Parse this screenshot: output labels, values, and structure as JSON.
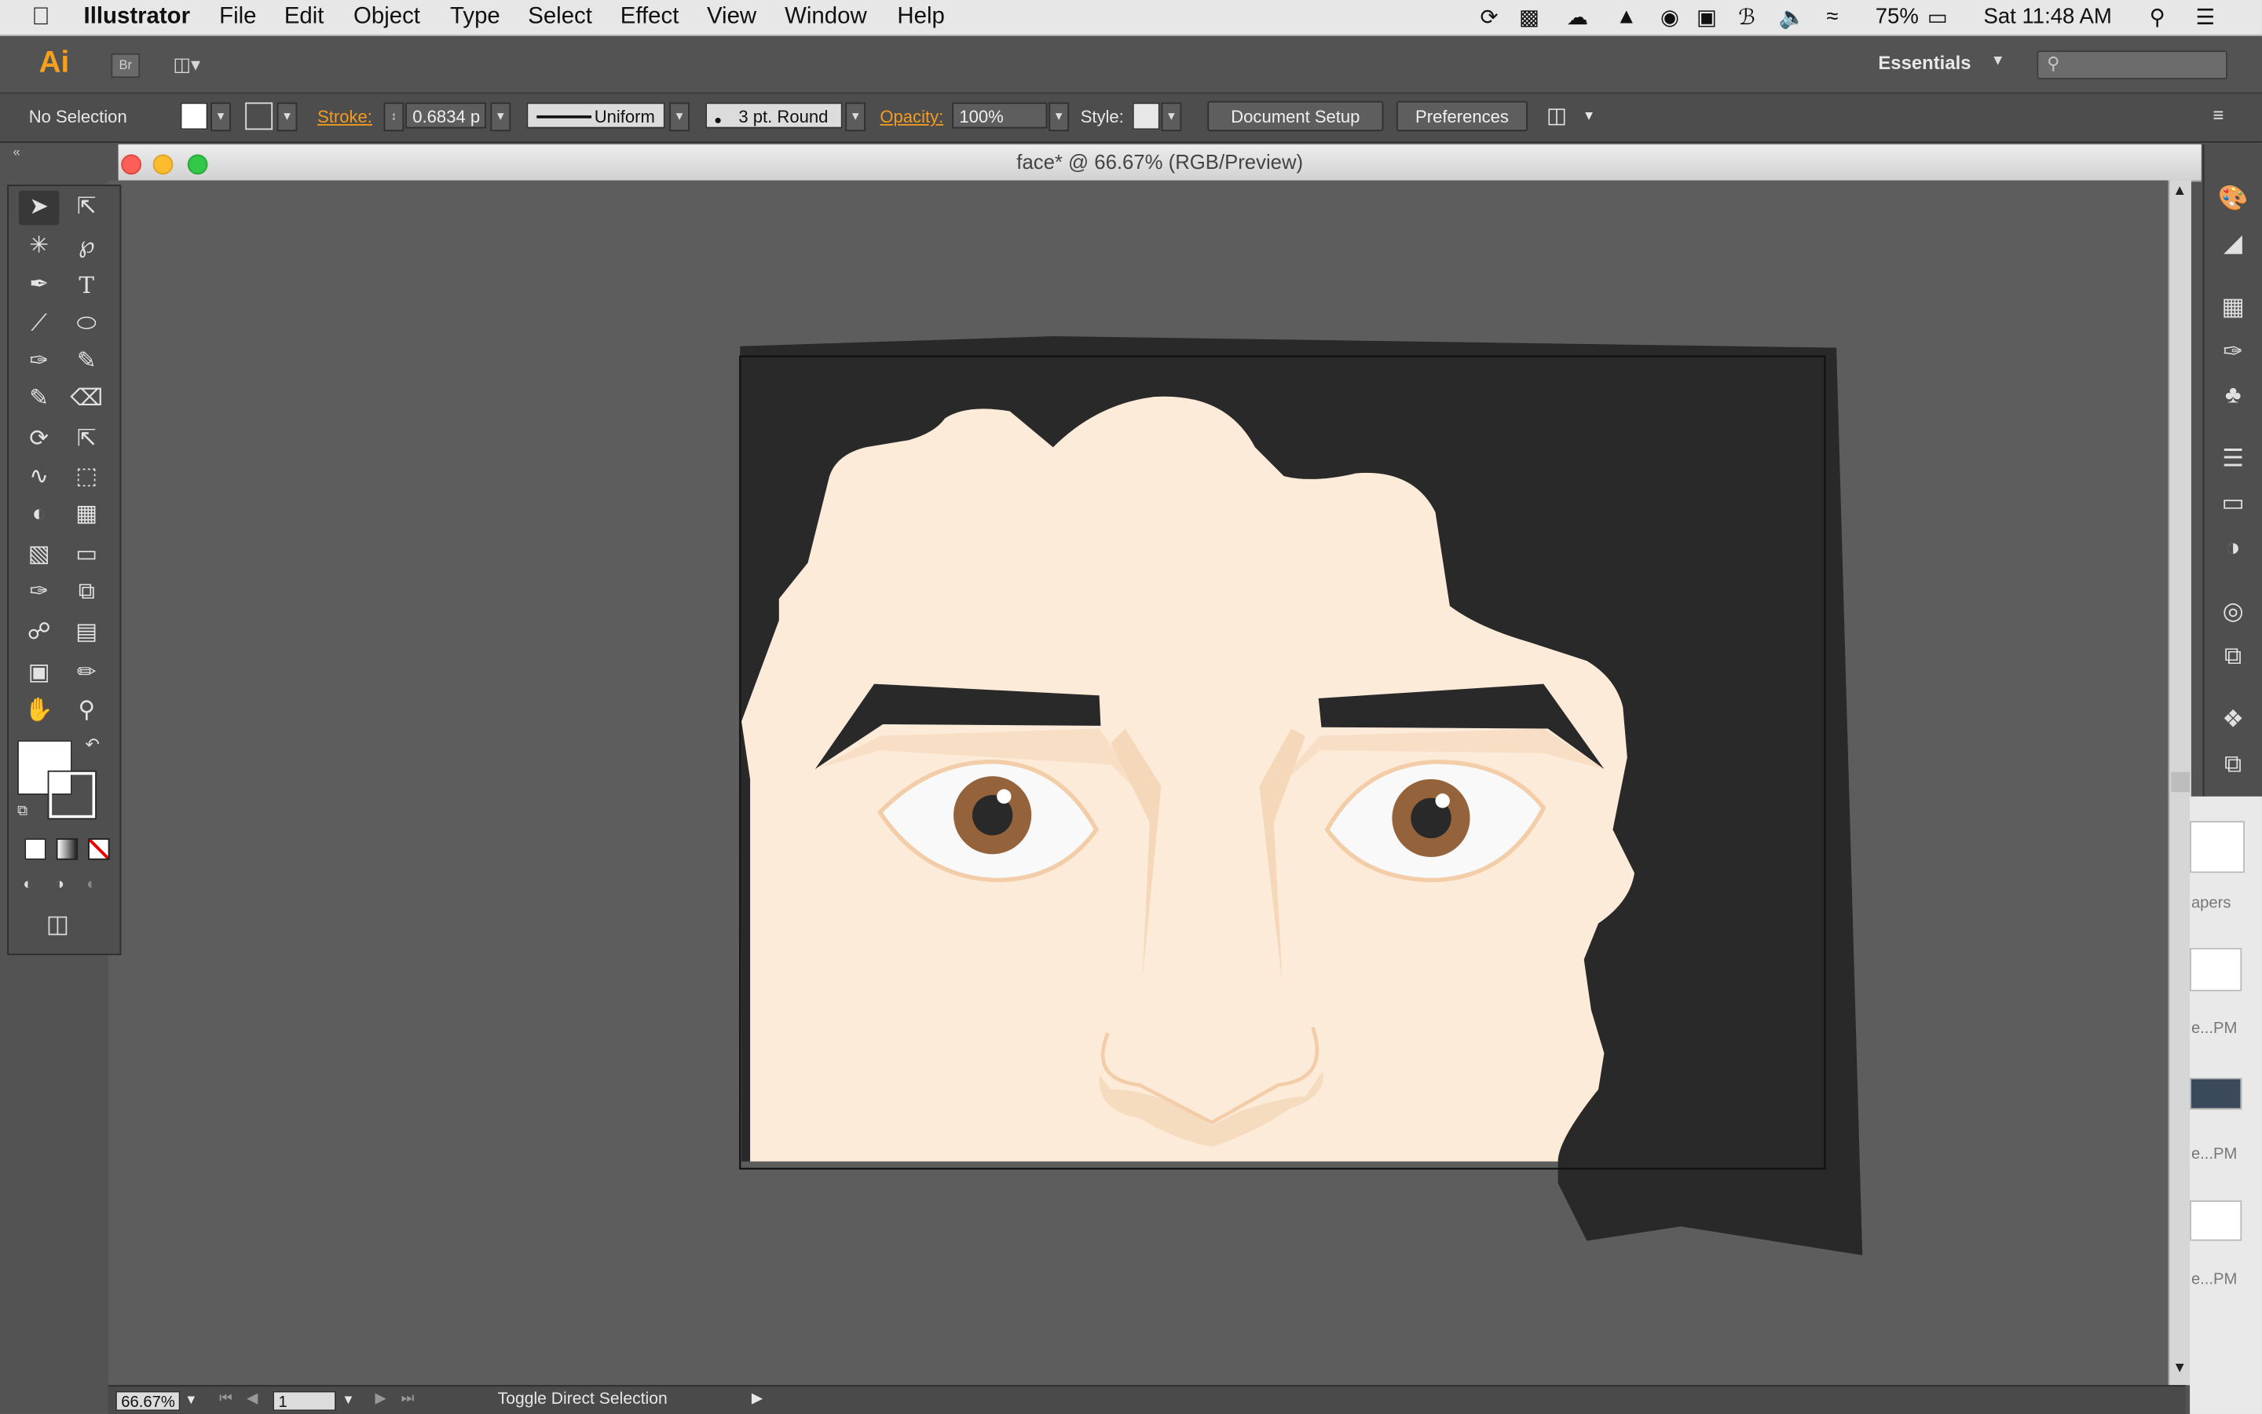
{
  "menubar": {
    "app_name": "Illustrator",
    "items": [
      "File",
      "Edit",
      "Object",
      "Type",
      "Select",
      "Effect",
      "View",
      "Window",
      "Help"
    ],
    "battery": "75%",
    "clock": "Sat 11:48 AM"
  },
  "appbar": {
    "logo": "Ai",
    "bridge_label": "Br",
    "workspace": "Essentials",
    "search_placeholder": ""
  },
  "controlbar": {
    "selection_status": "No Selection",
    "stroke_label": "Stroke:",
    "stroke_weight": "0.6834 p",
    "variable_width": "Uniform",
    "brush": "3 pt. Round",
    "opacity_label": "Opacity:",
    "opacity_value": "100%",
    "style_label": "Style:",
    "document_setup": "Document Setup",
    "preferences": "Preferences"
  },
  "document": {
    "title": "face* @ 66.67% (RGB/Preview)"
  },
  "statusbar": {
    "zoom": "66.67%",
    "artboard": "1",
    "status_text": "Toggle Direct Selection"
  },
  "thumbnails": {
    "captions": [
      "apers",
      "e...PM",
      "e...PM",
      "e...PM"
    ]
  },
  "colors": {
    "skin": "#fdebd9",
    "hair": "#292929",
    "iris": "#94633b",
    "shadow": "#f6dcbf"
  }
}
